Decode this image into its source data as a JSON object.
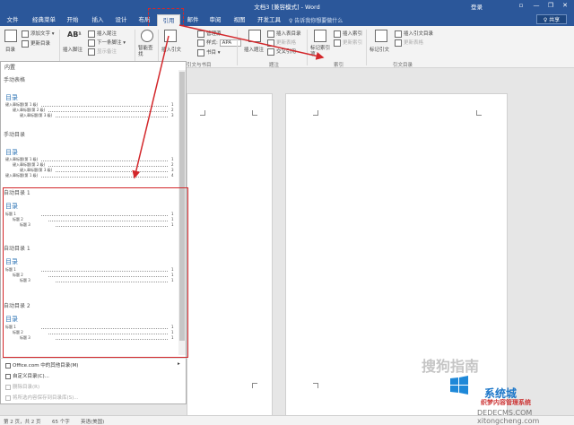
{
  "window": {
    "title": "文档3 [兼容模式] - Word",
    "signin": "登录",
    "minimize": "—",
    "restore": "❐",
    "close": "✕"
  },
  "tabs": [
    "文件",
    "经典菜单",
    "开始",
    "插入",
    "设计",
    "布局",
    "引用",
    "邮件",
    "审阅",
    "视图",
    "开发工具"
  ],
  "active_tab": "引用",
  "tell_me": "♀ 告诉我你想要做什么",
  "share": "♀ 共享",
  "ribbon": {
    "toc": {
      "label": "目录",
      "add_text": "添加文字 ▾",
      "update_toc": "更新目录"
    },
    "footnotes": {
      "insert_footnote": "插入脚注",
      "insert_endnote": "插入尾注",
      "next_footnote": "下一条脚注 ▾",
      "show_notes": "显示备注",
      "icon_text": "AB¹"
    },
    "research": {
      "smart_lookup": "智能查找"
    },
    "citations": {
      "insert_citation": "插入引文",
      "manage_sources": "管理源",
      "style_label": "样式:",
      "style_value": "APA",
      "bibliography": "书目 ▾"
    },
    "captions": {
      "insert_caption": "插入题注",
      "insert_table_of_figures": "插入表目录",
      "update_table": "更新表格",
      "cross_reference": "交叉引用"
    },
    "index": {
      "mark_entry": "标记索引项",
      "insert_index": "插入索引",
      "update_index": "更新索引"
    },
    "authorities": {
      "mark_citation": "标记引文",
      "insert_table": "插入引文目录",
      "update_table": "更新表格"
    },
    "groups": {
      "citations": "引文与书目",
      "captions": "题注",
      "index": "索引",
      "authorities": "引文目录"
    }
  },
  "gallery": {
    "header": "内置",
    "items": [
      {
        "title": "手动表格",
        "heading": "目录",
        "lines": [
          {
            "text": "键入章标题(第 1 级)",
            "page": "1"
          },
          {
            "text": "键入章标题(第 2 级)",
            "page": "2"
          },
          {
            "text": "键入章标题(第 3 级)",
            "page": "3"
          }
        ]
      },
      {
        "title": "手动目录",
        "heading": "目录",
        "lines": [
          {
            "text": "键入章标题(第 1 级)",
            "page": "1"
          },
          {
            "text": "键入章标题(第 2 级)",
            "page": "2"
          },
          {
            "text": "键入章标题(第 3 级)",
            "page": "3"
          },
          {
            "text": "键入章标题(第 1 级)",
            "page": "4"
          }
        ]
      },
      {
        "title": "自动目录 1",
        "heading": "目录",
        "lines": [
          {
            "text": "标题 1",
            "page": "1"
          },
          {
            "text": "标题 2",
            "page": "1"
          },
          {
            "text": "标题 3",
            "page": "1"
          }
        ]
      },
      {
        "title": "自动目录 1",
        "heading": "目录",
        "lines": [
          {
            "text": "标题 1",
            "page": "1"
          },
          {
            "text": "标题 2",
            "page": "1"
          },
          {
            "text": "标题 3",
            "page": "1"
          }
        ]
      },
      {
        "title": "自动目录 2",
        "heading": "目录",
        "lines": [
          {
            "text": "标题 1",
            "page": "1"
          },
          {
            "text": "标题 2",
            "page": "1"
          },
          {
            "text": "标题 3",
            "page": "1"
          }
        ]
      }
    ]
  },
  "menu": {
    "office_more": "Office.com 中的其他目录(M)",
    "custom_toc": "自定义目录(C)...",
    "remove_toc": "删除目录(R)",
    "save_selection": "将所选内容保存到目录库(S)..."
  },
  "status": {
    "page": "第 2 页，共 2 页",
    "words": "65 个字",
    "lang": "英语(美国)"
  },
  "watermarks": {
    "sogou": "搜狗指南",
    "brand": "系统城",
    "dede": "织梦内容管理系统",
    "domain1": "DEDECMS.COM",
    "domain2": "xitongcheng.com"
  },
  "colors": {
    "word_blue": "#2b579a",
    "annotation_red": "#d3272b",
    "heading_blue": "#2e74b5"
  }
}
